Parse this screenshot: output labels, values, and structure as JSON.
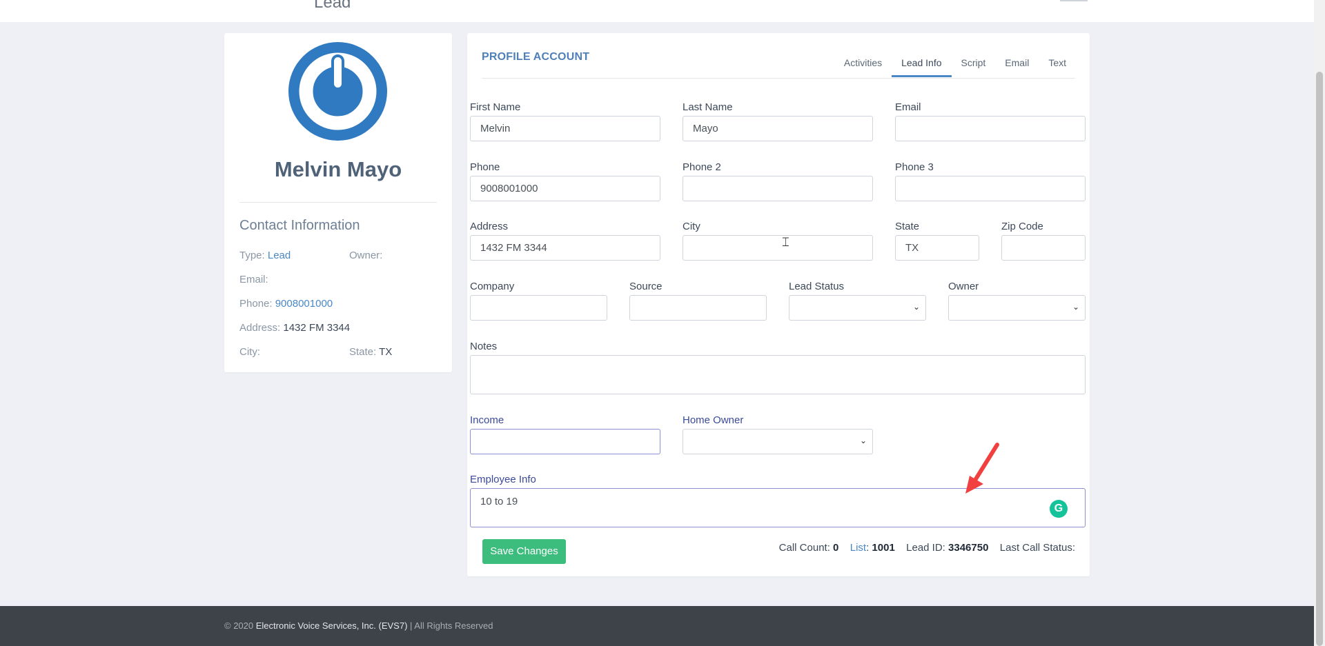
{
  "page": {
    "title": "Lead"
  },
  "profile": {
    "name": "Melvin Mayo",
    "contact_heading": "Contact Information",
    "type_label": "Type:",
    "type_value": "Lead",
    "owner_label": "Owner:",
    "owner_value": "",
    "email_label": "Email:",
    "email_value": "",
    "phone_label": "Phone:",
    "phone_value": "9008001000",
    "address_label": "Address:",
    "address_value": "1432 FM 3344",
    "city_label": "City:",
    "city_value": "",
    "state_label": "State:",
    "state_value": "TX"
  },
  "account": {
    "heading": "PROFILE ACCOUNT",
    "tabs": [
      {
        "label": "Activities"
      },
      {
        "label": "Lead Info",
        "active": true
      },
      {
        "label": "Script"
      },
      {
        "label": "Email"
      },
      {
        "label": "Text"
      }
    ]
  },
  "form": {
    "first_name": {
      "label": "First Name",
      "value": "Melvin"
    },
    "last_name": {
      "label": "Last Name",
      "value": "Mayo"
    },
    "email": {
      "label": "Email",
      "value": ""
    },
    "phone": {
      "label": "Phone",
      "value": "9008001000"
    },
    "phone2": {
      "label": "Phone 2",
      "value": ""
    },
    "phone3": {
      "label": "Phone 3",
      "value": ""
    },
    "address": {
      "label": "Address",
      "value": "1432 FM 3344"
    },
    "city": {
      "label": "City",
      "value": ""
    },
    "state": {
      "label": "State",
      "value": "TX"
    },
    "zip": {
      "label": "Zip Code",
      "value": ""
    },
    "company": {
      "label": "Company",
      "value": ""
    },
    "source": {
      "label": "Source",
      "value": ""
    },
    "lead_status": {
      "label": "Lead Status",
      "value": ""
    },
    "owner": {
      "label": "Owner",
      "value": ""
    },
    "notes": {
      "label": "Notes",
      "value": ""
    },
    "income": {
      "label": "Income",
      "value": ""
    },
    "home_owner": {
      "label": "Home Owner",
      "value": ""
    },
    "employee_info": {
      "label": "Employee Info",
      "value": "10 to 19"
    },
    "save_label": "Save Changes"
  },
  "meta": {
    "call_count_label": "Call Count:",
    "call_count": "0",
    "list_label": "List",
    "list_value": "1001",
    "lead_id_label": "Lead ID:",
    "lead_id": "3346750",
    "last_call_status_label": "Last Call Status:"
  },
  "footer": {
    "copyright_prefix": "© 2020",
    "company": "Electronic Voice Services, Inc. (EVS7)",
    "suffix": "| All Rights Reserved"
  },
  "colors": {
    "primary": "#4a87c6",
    "save_button": "#3dbd7d",
    "avatar": "#2f7ac0",
    "footer": "#3e4249",
    "annotation_arrow": "#f0403f"
  },
  "icons": [
    "power-logo-icon",
    "chevron-down-icon",
    "grammarly-icon",
    "text-cursor-icon",
    "red-arrow-icon"
  ]
}
